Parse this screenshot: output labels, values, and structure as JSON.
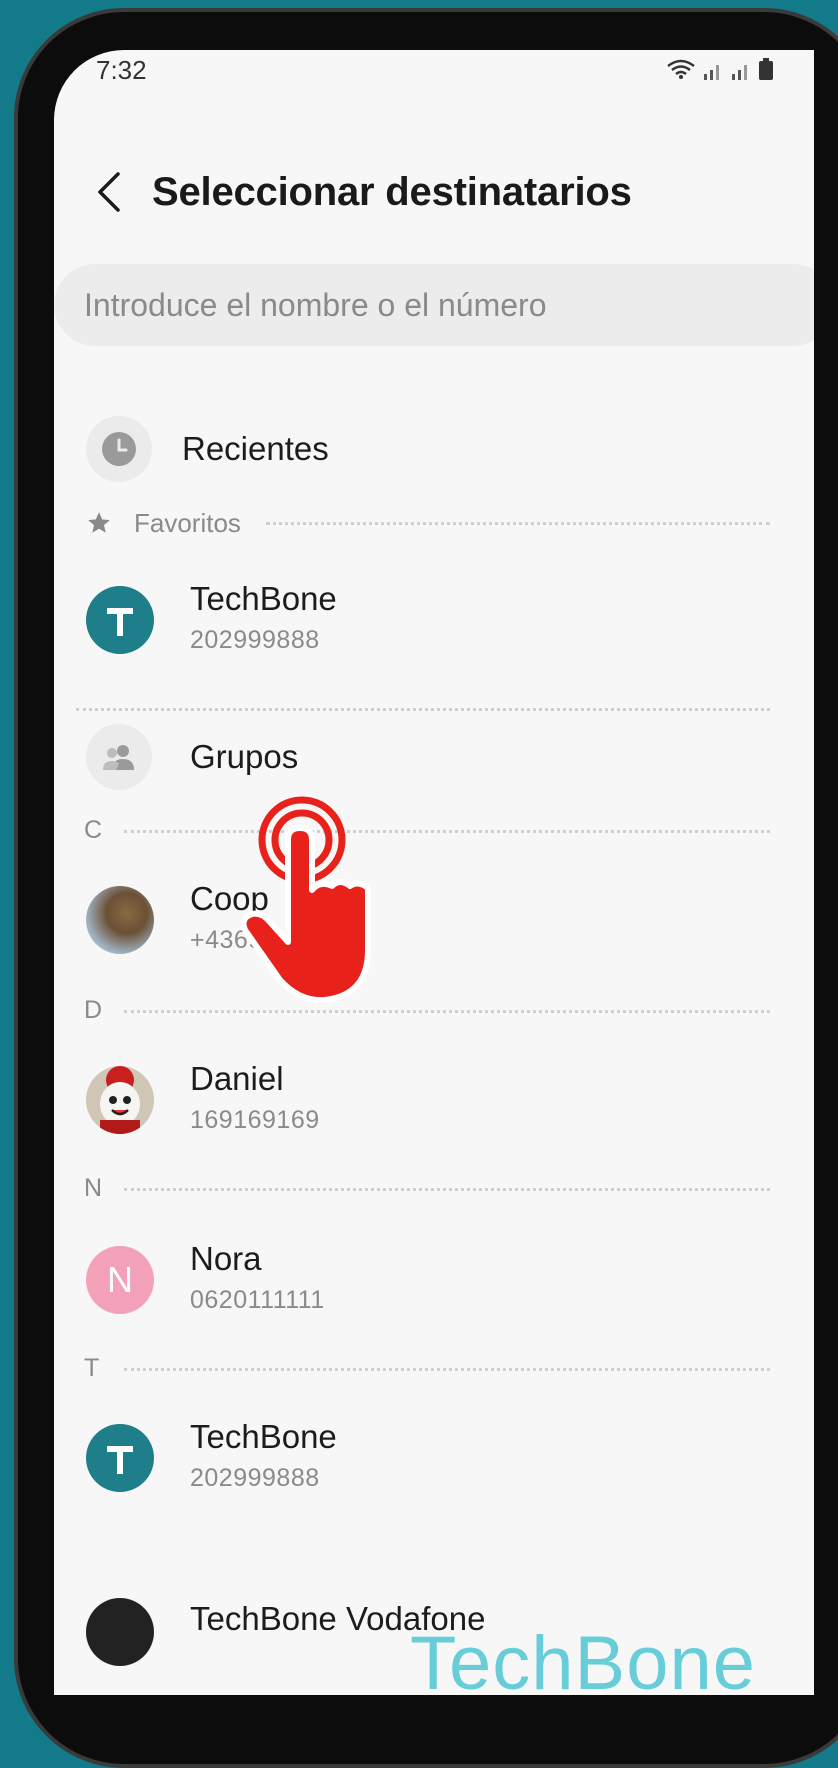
{
  "status": {
    "time": "7:32"
  },
  "header": {
    "title": "Seleccionar destinatarios"
  },
  "search": {
    "placeholder": "Introduce el nombre o el número"
  },
  "recents": {
    "label": "Recientes"
  },
  "favorites": {
    "label": "Favoritos",
    "items": [
      {
        "name": "TechBone",
        "number": "202999888",
        "initial": "T",
        "color": "#1e7e89"
      }
    ]
  },
  "groups": {
    "label": "Grupos"
  },
  "sections": [
    {
      "letter": "C",
      "contacts": [
        {
          "name": "Coop",
          "number": "+43690 27"
        }
      ]
    },
    {
      "letter": "D",
      "contacts": [
        {
          "name": "Daniel",
          "number": "169169169"
        }
      ]
    },
    {
      "letter": "N",
      "contacts": [
        {
          "name": "Nora",
          "number": "0620111111",
          "initial": "N",
          "color": "#f3a1b8"
        }
      ]
    },
    {
      "letter": "T",
      "contacts": [
        {
          "name": "TechBone",
          "number": "202999888",
          "initial": "T",
          "color": "#1e7e89"
        },
        {
          "name": "TechBone Vodafone",
          "number": ""
        }
      ]
    }
  ],
  "watermark": "TechBone",
  "colors": {
    "accent": "#1e7e89",
    "background": "#137a8a",
    "tap_indicator": "#e8221b"
  }
}
